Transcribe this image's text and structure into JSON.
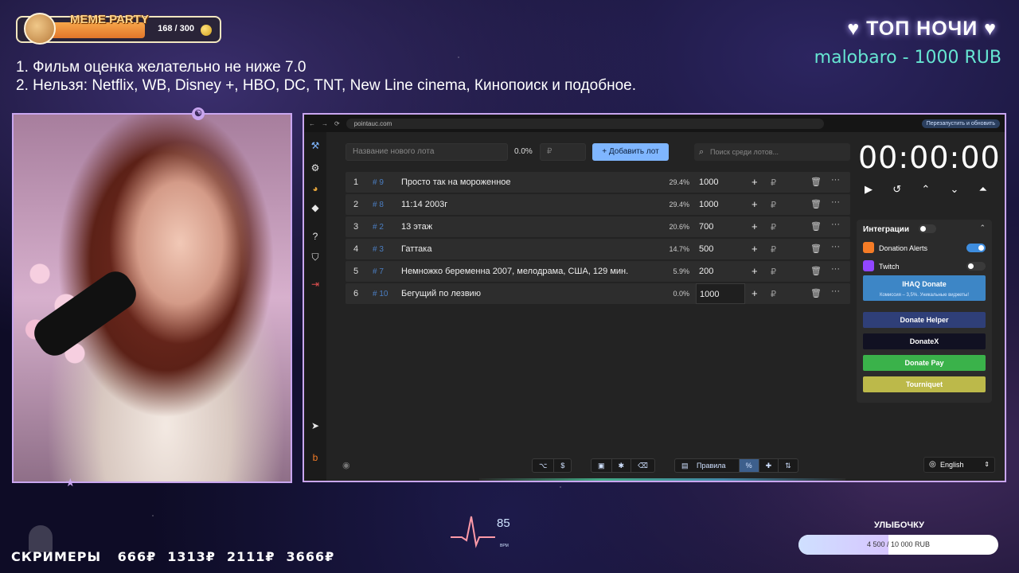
{
  "meme_party": {
    "title": "MEME PARTY",
    "count": "168 / 300",
    "progress": 0.56
  },
  "rules": [
    "1. Фильм оценка желательно не ниже 7.0",
    "2. Нельзя: Netflix, WB, Disney +, HBO, DC, TNT, New Line cinema, Кинопоиск и подобное."
  ],
  "top_night": {
    "title": "ТОП НОЧИ",
    "entry": "malobaro - 1000 RUB"
  },
  "browser": {
    "url": "pointauc.com",
    "reload_button": "Перезапустить и обновить"
  },
  "toolbar": {
    "lot_placeholder": "Название нового лота",
    "percent": "0.0%",
    "amount_placeholder": "₽",
    "add_button": "Добавить лот",
    "search_placeholder": "Поиск среди лотов..."
  },
  "lots": [
    {
      "index": "1",
      "id": "# 9",
      "name": "Просто так на мороженное",
      "percent": "29.4%",
      "amount": "1000"
    },
    {
      "index": "2",
      "id": "# 8",
      "name": "11:14 2003г",
      "percent": "29.4%",
      "amount": "1000"
    },
    {
      "index": "3",
      "id": "# 2",
      "name": "13 этаж",
      "percent": "20.6%",
      "amount": "700"
    },
    {
      "index": "4",
      "id": "# 3",
      "name": "Гаттака",
      "percent": "14.7%",
      "amount": "500"
    },
    {
      "index": "5",
      "id": "# 7",
      "name": "Немножко беременна 2007, мелодрама, США, 129 мин.",
      "percent": "5.9%",
      "amount": "200"
    },
    {
      "index": "6",
      "id": "# 10",
      "name": "Бегущий по лезвию",
      "percent": "0.0%",
      "amount": "1000"
    }
  ],
  "row_symbols": {
    "plus": "+",
    "currency": "₽",
    "more": "···"
  },
  "timer": {
    "time": "00:00:00"
  },
  "integrations": {
    "title": "Интеграции",
    "items": [
      {
        "label": "Donation Alerts",
        "enabled": true,
        "color": "#f57c26"
      },
      {
        "label": "Twitch",
        "enabled": false,
        "color": "#9146ff"
      }
    ],
    "ihaq": {
      "label": "IHAQ Donate",
      "sub": "Комиссия – 3,5%. Уникальные виджеты!"
    },
    "buttons": [
      {
        "label": "Donate Helper",
        "color": "#2f3f78"
      },
      {
        "label": "DonateX",
        "color": "#111122"
      },
      {
        "label": "Donate Pay",
        "color": "#3ab24a"
      },
      {
        "label": "Tourniquet",
        "color": "#bcb94a"
      }
    ]
  },
  "bottom_bar": {
    "rules_button": "Правила",
    "language": "English"
  },
  "screamers": {
    "label": "СКРИМЕРЫ",
    "amounts": [
      "666₽",
      "1313₽",
      "2111₽",
      "3666₽"
    ]
  },
  "bpm": {
    "value": "85",
    "label": "BPM"
  },
  "goal": {
    "title": "УЛЫБОЧКУ",
    "text": "4 500 / 10 000 RUB",
    "progress": 0.45
  }
}
